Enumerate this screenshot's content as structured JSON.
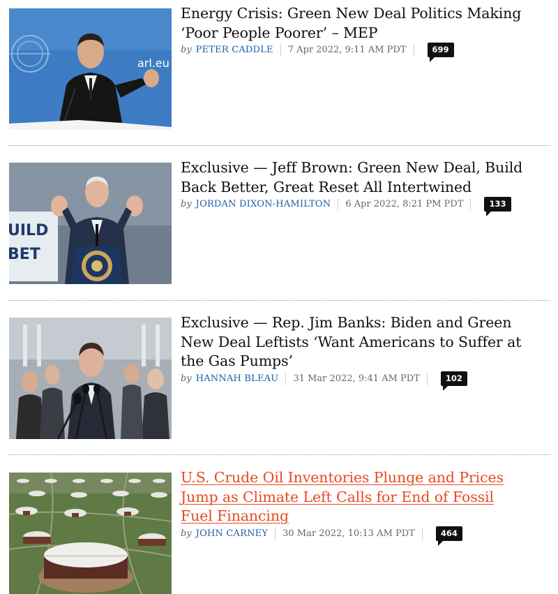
{
  "articles": [
    {
      "headline": "Energy Crisis: Green New Deal Politics Making ‘Poor People Poorer’ – MEP",
      "by": "by",
      "author": "PETER CADDLE",
      "date": "7 Apr 2022, 9:11 AM PDT",
      "comments": "699",
      "image_text": "arl.eu",
      "active": false
    },
    {
      "headline": "Exclusive — Jeff Brown: Green New Deal, Build Back Better, Great Reset All Intertwined",
      "by": "by",
      "author": "JORDAN DIXON-HAMILTON",
      "date": "6 Apr 2022, 8:21 PM PDT",
      "comments": "133",
      "image_text_1": "UILD",
      "image_text_2": "BET",
      "active": false
    },
    {
      "headline": "Exclusive — Rep. Jim Banks: Biden and Green New Deal Leftists ‘Want Americans to Suffer at the Gas Pumps’",
      "by": "by",
      "author": "HANNAH BLEAU",
      "date": "31 Mar 2022, 9:41 AM PDT",
      "comments": "102",
      "active": false
    },
    {
      "headline": "U.S. Crude Oil Inventories Plunge and Prices Jump as Climate Left Calls for End of Fossil Fuel Financing",
      "by": "by",
      "author": "JOHN CARNEY",
      "date": "30 Mar 2022, 10:13 AM PDT",
      "comments": "464",
      "active": true
    }
  ],
  "colors": {
    "headline": "#111111",
    "headline_active": "#e84a1f",
    "author": "#1a5fa8",
    "meta": "#666666",
    "comment_badge": "#111111"
  }
}
